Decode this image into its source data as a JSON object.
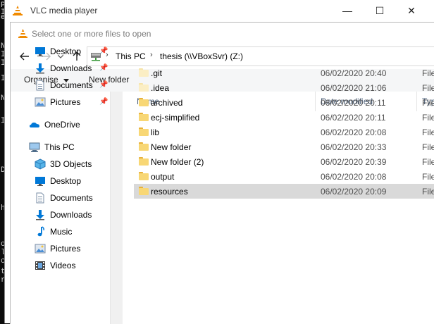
{
  "terminal": {
    "chars": [
      "Pr",
      "I",
      "e",
      "N",
      "I",
      "I",
      "I",
      "N",
      "I",
      "D",
      "h",
      "o",
      "le",
      "ce",
      "t",
      "r"
    ]
  },
  "vlc_window": {
    "title": "VLC media player",
    "minimize": "—",
    "maximize": "☐",
    "close": "✕"
  },
  "dialog": {
    "title": "Select one or more files to open",
    "address": {
      "crumbs": [
        "This PC",
        "thesis (\\\\VBoxSvr) (Z:)"
      ],
      "separator": "›"
    },
    "toolbar": {
      "organise": "Organise",
      "new_folder": "New folder"
    },
    "nav": {
      "items": [
        {
          "label": "Desktop",
          "icon": "desktop-icon",
          "pinned": true
        },
        {
          "label": "Downloads",
          "icon": "downloads-icon",
          "pinned": true
        },
        {
          "label": "Documents",
          "icon": "documents-icon",
          "pinned": true
        },
        {
          "label": "Pictures",
          "icon": "pictures-icon",
          "pinned": true
        },
        {
          "label": "OneDrive",
          "icon": "onedrive-icon"
        },
        {
          "label": "This PC",
          "icon": "this-pc-icon"
        },
        {
          "label": "3D Objects",
          "icon": "3d-objects-icon"
        },
        {
          "label": "Desktop",
          "icon": "desktop-icon"
        },
        {
          "label": "Documents",
          "icon": "documents-icon"
        },
        {
          "label": "Downloads",
          "icon": "downloads-icon"
        },
        {
          "label": "Music",
          "icon": "music-icon"
        },
        {
          "label": "Pictures",
          "icon": "pictures-icon"
        },
        {
          "label": "Videos",
          "icon": "videos-icon"
        }
      ]
    },
    "columns": {
      "name": "Name",
      "date": "Date modified",
      "type": "Typ"
    },
    "files": [
      {
        "name": ".git",
        "date": "06/02/2020 20:40",
        "type": "File",
        "hidden": true
      },
      {
        "name": ".idea",
        "date": "06/02/2020 21:06",
        "type": "File",
        "hidden": true
      },
      {
        "name": "archived",
        "date": "06/02/2020 20:11",
        "type": "File"
      },
      {
        "name": "ecj-simplified",
        "date": "06/02/2020 20:11",
        "type": "File"
      },
      {
        "name": "lib",
        "date": "06/02/2020 20:08",
        "type": "File"
      },
      {
        "name": "New folder",
        "date": "06/02/2020 20:33",
        "type": "File"
      },
      {
        "name": "New folder (2)",
        "date": "06/02/2020 20:39",
        "type": "File"
      },
      {
        "name": "output",
        "date": "06/02/2020 20:08",
        "type": "File"
      },
      {
        "name": "resources",
        "date": "06/02/2020 20:09",
        "type": "File",
        "selected": true
      }
    ]
  },
  "colors": {
    "accent": "#0078d7",
    "folder": "#f8d775",
    "folder_dark": "#e8b13a",
    "header_text": "#4c607a",
    "selected_row": "#d9d9d9",
    "vlc_cone": "#f08a00"
  }
}
